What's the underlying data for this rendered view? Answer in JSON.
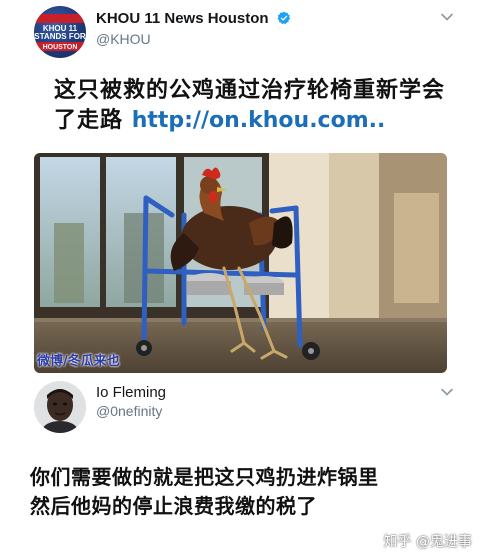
{
  "tweet": {
    "author_name": "KHOU 11 News Houston",
    "author_handle": "@KHOU",
    "avatar_text": [
      "KHOU 11",
      "STANDS FOR",
      "HOUSTON"
    ],
    "headline_text": "这只被救的公鸡通过治疗轮椅重新学会了走路",
    "headline_link": "http://on.khou.com..",
    "photo_watermark": "微博/冬瓜来也",
    "link_color": "#1b6fb8"
  },
  "reply": {
    "author_name": "Io Fleming",
    "author_handle": "@0nefinity",
    "text_line1": "你们需要做的就是把这只鸡扔进炸锅里",
    "text_line2": "然后他妈的停止浪费我缴的税了"
  },
  "footer_watermark": "知乎 @鬼进事",
  "icons": {
    "verified": "verified-badge-icon",
    "more": "chevron-down-icon"
  },
  "colors": {
    "verified_blue": "#1da1f2",
    "handle_gray": "#657786"
  }
}
